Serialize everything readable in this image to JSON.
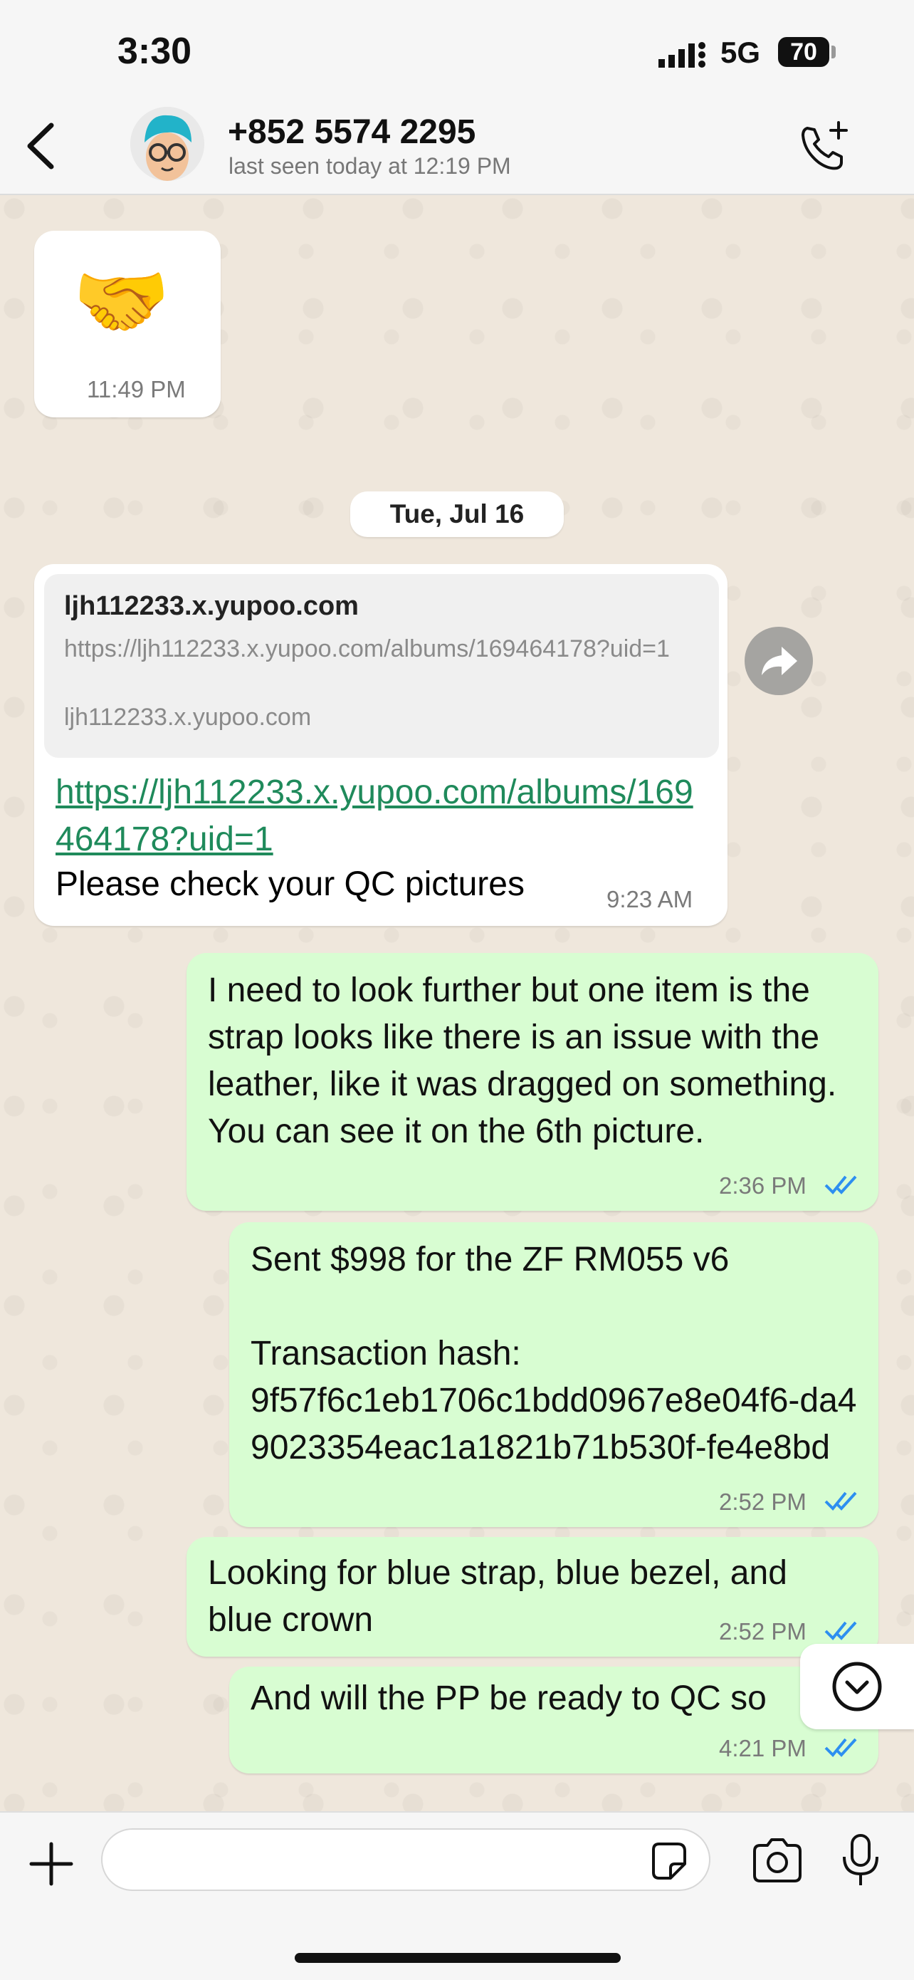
{
  "status_bar": {
    "time": "3:30",
    "network": "5G",
    "battery": "70"
  },
  "header": {
    "contact_name": "+852 5574 2295",
    "last_seen": "last seen today at 12:19 PM"
  },
  "messages": {
    "handshake": {
      "emoji": "🤝",
      "time": "11:49 PM"
    },
    "date_separator": "Tue, Jul 16",
    "link_message": {
      "preview_title": "ljh112233.x.yupoo.com",
      "preview_url": "https://ljh112233.x.yupoo.com/albums/169464178?uid=1",
      "preview_domain": "ljh112233.x.yupoo.com",
      "link_text": "https://ljh112233.x.yupoo.com/albums/169464178?uid=1",
      "text": "Please check your QC pictures",
      "time": "9:23 AM"
    },
    "out1": {
      "text": "I need to look further but one item is the strap looks like there is an issue with the leather, like it was dragged on something. You can see it on the 6th picture.",
      "time": "2:36 PM"
    },
    "out2": {
      "text": "Sent $998 for the ZF RM055 v6\n\nTransaction hash:\n9f57f6c1eb1706c1bdd0967e8e04f6-da49023354eac1a1821b71b530f-fe4e8bd",
      "time": "2:52 PM"
    },
    "out3": {
      "text": "Looking for blue strap, blue bezel, and blue crown",
      "time": "2:52 PM"
    },
    "out4": {
      "text": "And will the PP be ready to QC so",
      "time": "4:21 PM"
    }
  },
  "colors": {
    "outgoing_bubble": "#d8fdd2",
    "incoming_bubble": "#ffffff",
    "link": "#1f8a5b",
    "read_ticks": "#2d8ff0"
  },
  "icons": [
    "back-icon",
    "avatar",
    "add-call-icon",
    "forward-icon",
    "scroll-down-icon",
    "plus-icon",
    "sticker-icon",
    "camera-icon",
    "mic-icon"
  ]
}
